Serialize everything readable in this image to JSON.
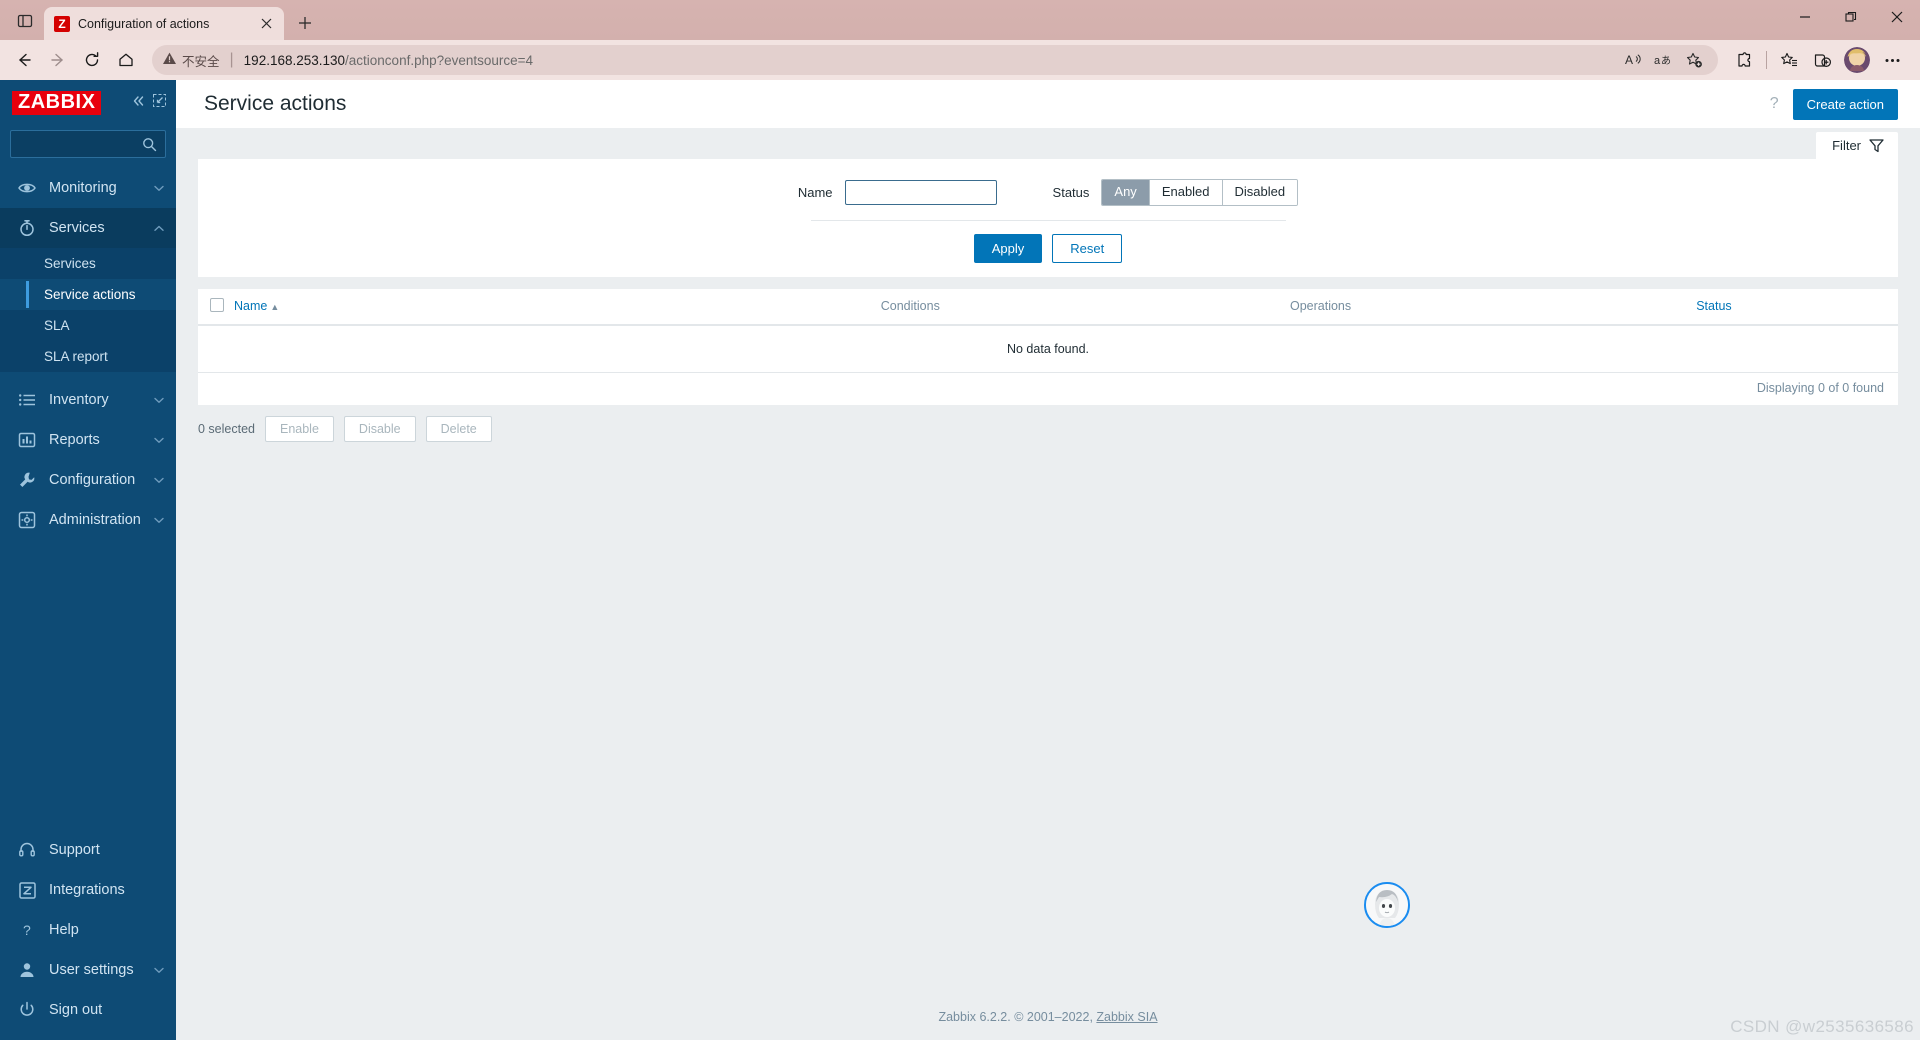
{
  "browser": {
    "tab": {
      "favicon_letter": "Z",
      "title": "Configuration of actions",
      "close_icon": "close-icon"
    },
    "new_tab_label": "+",
    "window_controls": {
      "minimize": "—",
      "maximize": "❐",
      "close": "✕"
    },
    "nav": {
      "back": "back-arrow-icon",
      "forward": "forward-arrow-icon",
      "reload": "reload-icon",
      "home": "home-icon"
    },
    "url": {
      "warning_icon": "warning-triangle-icon",
      "warning_text": "不安全",
      "host": "192.168.253.130",
      "path": "/actionconf.php?eventsource=4"
    },
    "toolbar_icons": [
      "read-aloud-icon",
      "translate-icon",
      "add-favorite-icon",
      "extensions-icon",
      "collections-icon",
      "browser-essentials-icon",
      "profile-avatar",
      "settings-more-icon"
    ]
  },
  "sidebar": {
    "logo": "ZABBIX",
    "collapse_icon": "«",
    "compact_icon": "collapse-panel-icon",
    "search": {
      "value": "",
      "placeholder": "",
      "icon": "search-icon"
    },
    "items": [
      {
        "label": "Monitoring",
        "icon": "eye-icon",
        "chevron": "⌄",
        "expanded": false
      },
      {
        "label": "Services",
        "icon": "stopwatch-icon",
        "chevron": "⌃",
        "expanded": true
      },
      {
        "label": "Inventory",
        "icon": "list-icon",
        "chevron": "⌄",
        "expanded": false
      },
      {
        "label": "Reports",
        "icon": "bar-chart-icon",
        "chevron": "⌄",
        "expanded": false
      },
      {
        "label": "Configuration",
        "icon": "wrench-icon",
        "chevron": "⌄",
        "expanded": false
      },
      {
        "label": "Administration",
        "icon": "gear-icon",
        "chevron": "⌄",
        "expanded": false
      }
    ],
    "services_sub": [
      {
        "label": "Services",
        "active": false
      },
      {
        "label": "Service actions",
        "active": true
      },
      {
        "label": "SLA",
        "active": false
      },
      {
        "label": "SLA report",
        "active": false
      }
    ],
    "bottom_items": [
      {
        "label": "Support",
        "icon": "headset-icon",
        "chevron": ""
      },
      {
        "label": "Integrations",
        "icon": "zabbix-z-icon",
        "chevron": ""
      },
      {
        "label": "Help",
        "icon": "question-mark-icon",
        "chevron": ""
      },
      {
        "label": "User settings",
        "icon": "user-icon",
        "chevron": "⌄"
      },
      {
        "label": "Sign out",
        "icon": "power-icon",
        "chevron": ""
      }
    ]
  },
  "header": {
    "title": "Service actions",
    "help_icon": "?",
    "create_button": "Create action"
  },
  "filter": {
    "tab_label": "Filter",
    "tab_icon": "funnel-icon",
    "name_label": "Name",
    "name_value": "",
    "name_placeholder": "",
    "status_label": "Status",
    "status_options": [
      "Any",
      "Enabled",
      "Disabled"
    ],
    "status_selected": "Any",
    "apply_label": "Apply",
    "reset_label": "Reset"
  },
  "table": {
    "columns": [
      "Name",
      "Conditions",
      "Operations",
      "Status"
    ],
    "sort_column": "Name",
    "sort_caret": "▲",
    "empty_message": "No data found.",
    "displaying": "Displaying 0 of 0 found"
  },
  "bulk": {
    "selected_text": "0 selected",
    "buttons": [
      "Enable",
      "Disable",
      "Delete"
    ]
  },
  "footer": {
    "text": "Zabbix 6.2.2. © 2001–2022, ",
    "link": "Zabbix SIA"
  },
  "watermark": "CSDN @w2535636586",
  "floating_widget": {
    "name": "chat-avatar-widget"
  }
}
